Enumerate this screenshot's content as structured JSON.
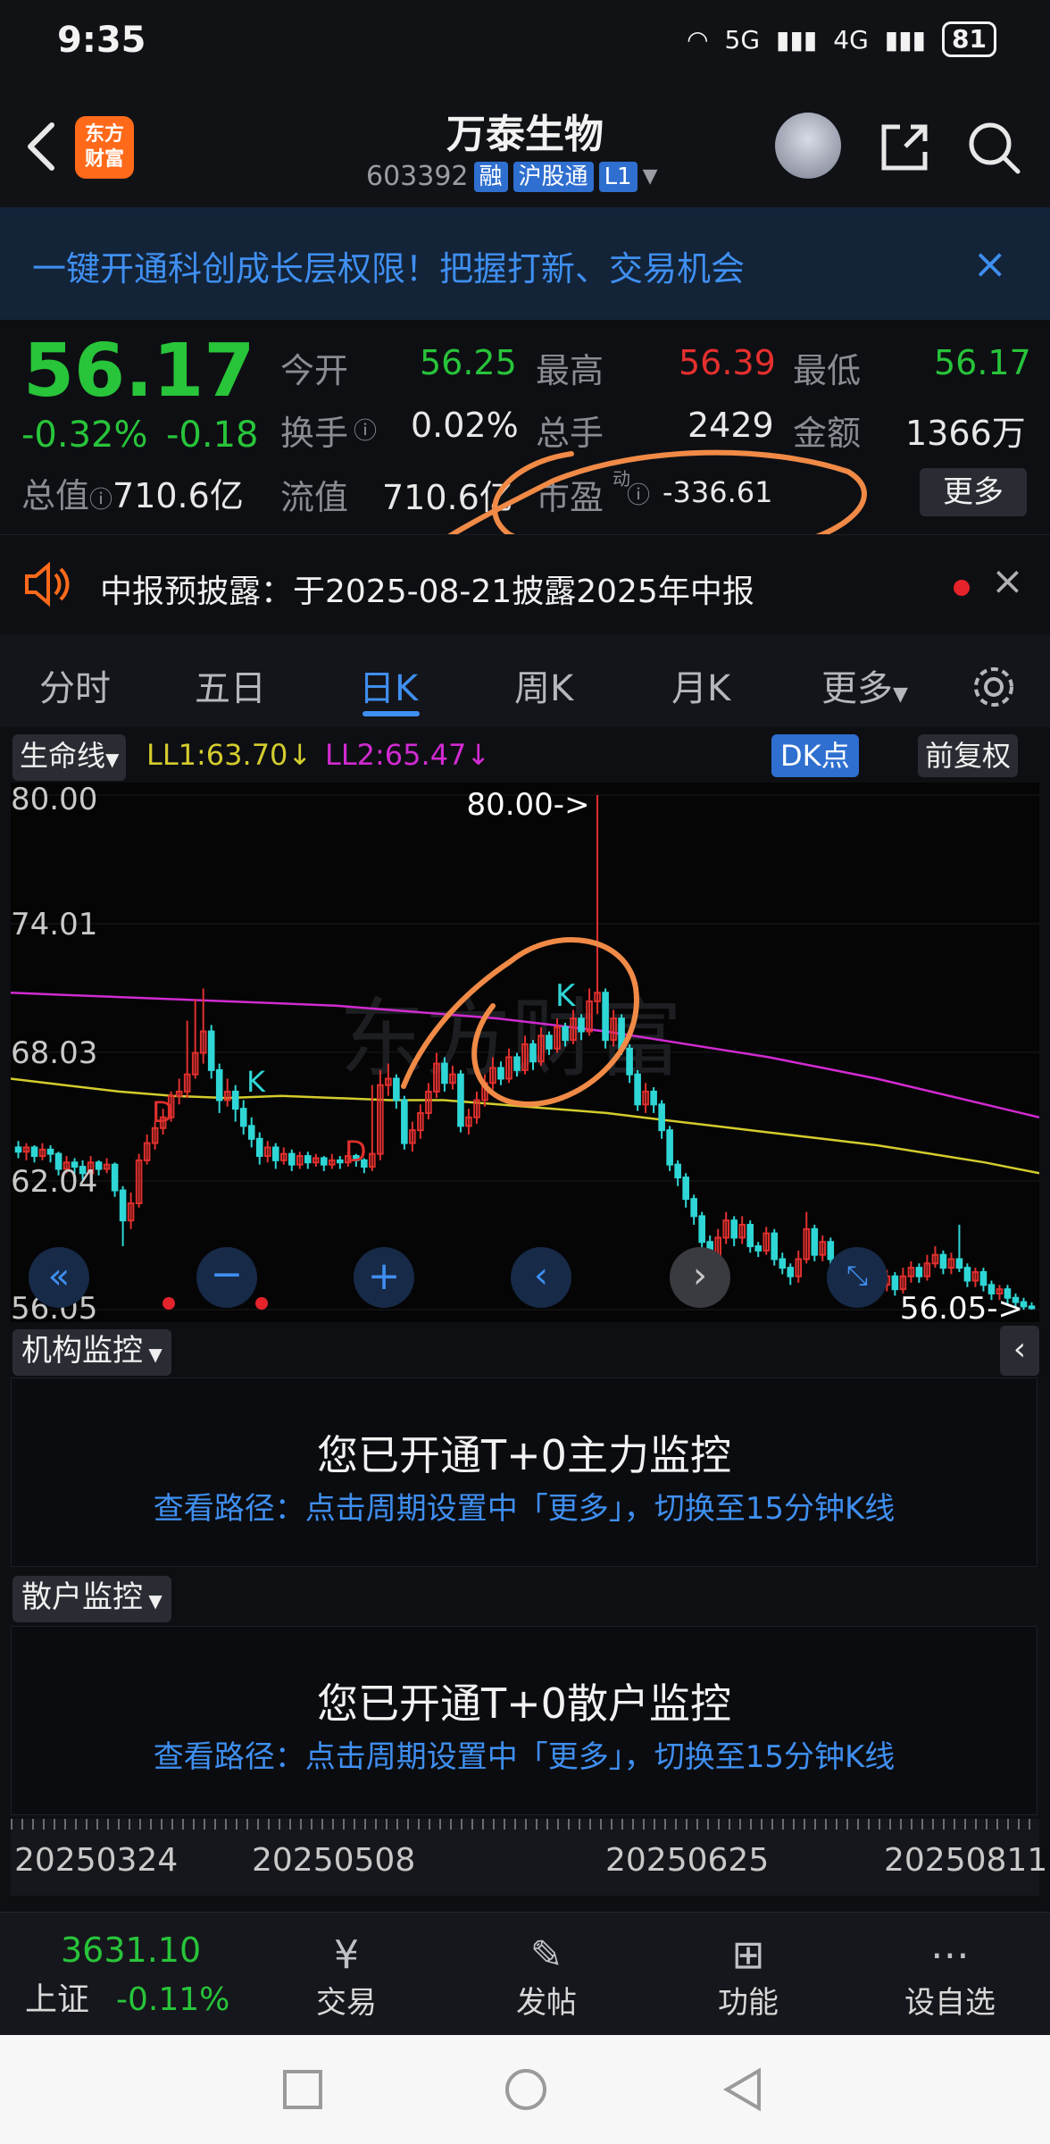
{
  "status_bar": {
    "time": "9:35",
    "net1": "5G",
    "net2": "4G",
    "battery": "81"
  },
  "header": {
    "logo_line1": "东方",
    "logo_line2": "财富",
    "stock_name": "万泰生物",
    "code": "603392",
    "tag_margin": "融",
    "tag_connect": "沪股通",
    "tag_level": "L1"
  },
  "banner": {
    "text": "一键开通科创成长层权限！把握打新、交易机会",
    "close": "×"
  },
  "quote": {
    "price": "56.17",
    "change_pct": "-0.32%",
    "change": "-0.18",
    "total_value_label": "总值",
    "total_value": "710.6亿",
    "open_label": "今开",
    "open": "56.25",
    "high_label": "最高",
    "high": "56.39",
    "low_label": "最低",
    "low": "56.17",
    "turnover_label": "换手",
    "turnover": "0.02%",
    "volume_label": "总手",
    "volume": "2429",
    "amount_label": "金额",
    "amount": "1366万",
    "float_label": "流值",
    "float_value": "710.6亿",
    "pe_label": "市盈",
    "pe_sup": "动",
    "pe": "-336.61",
    "more": "更多"
  },
  "notice": {
    "text": "中报预披露：于2025-08-21披露2025年中报"
  },
  "tabs": [
    {
      "label": "分时"
    },
    {
      "label": "五日"
    },
    {
      "label": "日K"
    },
    {
      "label": "周K"
    },
    {
      "label": "月K"
    },
    {
      "label": "更多"
    }
  ],
  "indicator": {
    "name": "生命线",
    "ll1": "LL1:63.70↓",
    "ll2": "LL2:65.47↓",
    "dk": "DK点",
    "adjust": "前复权"
  },
  "chart_data": {
    "type": "candlestick",
    "y_ticks": [
      "80.00",
      "74.01",
      "68.03",
      "62.04",
      "56.05"
    ],
    "ylim": [
      56.05,
      80.0
    ],
    "max_label": "80.00->",
    "min_label": "56.05->",
    "markers": [
      "D",
      "K",
      "D",
      "K"
    ],
    "x_ticks": [
      "20250324",
      "20250508",
      "20250625",
      "20250811"
    ],
    "colors": {
      "up": "#e0302e",
      "down": "#2fd6d6",
      "ll1": "#d4cc2e",
      "ll2": "#d12bd1"
    },
    "candles": [
      [
        63.6,
        63.4,
        63.9,
        63.1
      ],
      [
        63.4,
        63.6,
        63.8,
        63.0
      ],
      [
        63.6,
        63.2,
        63.7,
        62.9
      ],
      [
        63.2,
        63.5,
        63.8,
        63.0
      ],
      [
        63.5,
        63.3,
        63.7,
        62.9
      ],
      [
        63.3,
        62.6,
        63.4,
        62.3
      ],
      [
        62.6,
        62.9,
        63.2,
        62.4
      ],
      [
        62.9,
        62.7,
        63.1,
        62.4
      ],
      [
        62.7,
        62.4,
        63.0,
        62.1
      ],
      [
        62.4,
        62.9,
        63.2,
        62.2
      ],
      [
        62.9,
        62.6,
        63.0,
        62.3
      ],
      [
        62.6,
        62.8,
        63.1,
        62.4
      ],
      [
        62.8,
        61.6,
        62.9,
        61.3
      ],
      [
        61.6,
        60.2,
        61.8,
        59.0
      ],
      [
        60.2,
        61.0,
        61.5,
        59.8
      ],
      [
        61.0,
        63.0,
        63.3,
        60.8
      ],
      [
        63.0,
        63.8,
        64.2,
        62.8
      ],
      [
        63.8,
        64.5,
        64.8,
        63.5
      ],
      [
        64.5,
        65.0,
        65.4,
        64.2
      ],
      [
        65.0,
        66.0,
        66.2,
        64.8
      ],
      [
        66.0,
        66.2,
        66.8,
        65.6
      ],
      [
        66.2,
        67.0,
        69.5,
        65.9
      ],
      [
        67.0,
        68.0,
        70.5,
        66.8
      ],
      [
        68.0,
        69.0,
        71.0,
        67.5
      ],
      [
        69.0,
        67.2,
        69.3,
        66.8
      ],
      [
        67.2,
        65.8,
        67.5,
        65.2
      ],
      [
        65.8,
        66.2,
        66.8,
        65.5
      ],
      [
        66.2,
        65.4,
        66.5,
        64.8
      ],
      [
        65.4,
        64.6,
        65.8,
        64.2
      ],
      [
        64.6,
        64.0,
        65.0,
        63.6
      ],
      [
        64.0,
        63.2,
        64.3,
        62.8
      ],
      [
        63.2,
        63.6,
        63.9,
        62.9
      ],
      [
        63.6,
        63.0,
        63.8,
        62.6
      ],
      [
        63.0,
        63.3,
        63.6,
        62.8
      ],
      [
        63.3,
        62.8,
        63.5,
        62.5
      ],
      [
        62.8,
        63.2,
        63.4,
        62.6
      ],
      [
        63.2,
        62.9,
        63.4,
        62.6
      ],
      [
        62.9,
        63.1,
        63.3,
        62.7
      ],
      [
        63.1,
        62.8,
        63.2,
        62.5
      ],
      [
        62.8,
        63.0,
        63.3,
        62.6
      ],
      [
        63.0,
        62.9,
        63.2,
        62.6
      ],
      [
        62.9,
        63.2,
        63.4,
        62.7
      ],
      [
        63.2,
        63.0,
        63.3,
        62.7
      ],
      [
        63.0,
        62.7,
        63.1,
        62.4
      ],
      [
        62.7,
        63.3,
        66.5,
        62.5
      ],
      [
        63.3,
        66.5,
        67.2,
        63.0
      ],
      [
        66.5,
        66.8,
        67.5,
        66.0
      ],
      [
        66.8,
        65.8,
        67.0,
        65.4
      ],
      [
        65.8,
        63.8,
        66.0,
        63.5
      ],
      [
        63.8,
        64.4,
        64.8,
        63.4
      ],
      [
        64.4,
        65.2,
        65.6,
        64.0
      ],
      [
        65.2,
        66.2,
        66.6,
        64.9
      ],
      [
        66.2,
        67.5,
        68.0,
        65.9
      ],
      [
        67.5,
        66.6,
        67.8,
        66.2
      ],
      [
        66.6,
        67.0,
        67.4,
        66.3
      ],
      [
        67.0,
        64.6,
        67.2,
        64.3
      ],
      [
        64.6,
        65.0,
        65.4,
        64.2
      ],
      [
        65.0,
        65.8,
        66.2,
        64.7
      ],
      [
        65.8,
        66.6,
        67.0,
        65.5
      ],
      [
        66.6,
        67.3,
        67.8,
        66.3
      ],
      [
        67.3,
        66.8,
        67.6,
        66.5
      ],
      [
        66.8,
        67.8,
        68.2,
        66.6
      ],
      [
        67.8,
        67.2,
        68.0,
        66.9
      ],
      [
        67.2,
        68.4,
        68.8,
        67.0
      ],
      [
        68.4,
        67.6,
        68.6,
        67.2
      ],
      [
        67.6,
        68.8,
        69.2,
        67.4
      ],
      [
        68.8,
        68.2,
        69.0,
        67.9
      ],
      [
        68.2,
        69.2,
        69.6,
        68.0
      ],
      [
        69.2,
        68.6,
        69.4,
        68.3
      ],
      [
        68.6,
        69.6,
        70.0,
        68.4
      ],
      [
        69.6,
        69.0,
        69.8,
        68.6
      ],
      [
        69.0,
        70.4,
        71.0,
        68.8
      ],
      [
        70.4,
        70.8,
        80.0,
        69.8
      ],
      [
        70.8,
        68.6,
        71.0,
        68.2
      ],
      [
        68.6,
        69.6,
        70.0,
        68.3
      ],
      [
        69.6,
        68.2,
        69.8,
        67.9
      ],
      [
        68.2,
        67.0,
        68.4,
        66.6
      ],
      [
        67.0,
        65.6,
        67.2,
        65.3
      ],
      [
        65.6,
        66.2,
        66.6,
        65.2
      ],
      [
        66.2,
        65.6,
        66.4,
        65.2
      ],
      [
        65.6,
        64.4,
        65.8,
        64.0
      ],
      [
        64.4,
        62.8,
        64.6,
        62.5
      ],
      [
        62.8,
        62.2,
        63.0,
        61.8
      ],
      [
        62.2,
        61.2,
        62.4,
        60.8
      ],
      [
        61.2,
        60.4,
        61.4,
        60.0
      ],
      [
        60.4,
        59.2,
        60.6,
        58.9
      ],
      [
        59.2,
        58.6,
        59.5,
        58.2
      ],
      [
        58.6,
        59.4,
        59.8,
        58.3
      ],
      [
        59.4,
        60.2,
        60.6,
        59.1
      ],
      [
        60.2,
        59.4,
        60.4,
        59.0
      ],
      [
        59.4,
        60.0,
        60.4,
        59.1
      ],
      [
        60.0,
        59.0,
        60.2,
        58.7
      ],
      [
        59.0,
        58.8,
        59.2,
        58.5
      ],
      [
        58.8,
        59.6,
        59.9,
        58.6
      ],
      [
        59.6,
        58.4,
        59.8,
        58.1
      ],
      [
        58.4,
        58.0,
        58.7,
        57.7
      ],
      [
        58.0,
        57.6,
        58.2,
        57.2
      ],
      [
        57.6,
        58.4,
        58.8,
        57.3
      ],
      [
        58.4,
        59.8,
        60.6,
        58.2
      ],
      [
        59.8,
        58.6,
        60.0,
        58.3
      ],
      [
        58.6,
        59.2,
        59.5,
        58.3
      ],
      [
        59.2,
        58.4,
        59.4,
        58.1
      ],
      [
        58.4,
        58.0,
        58.6,
        57.7
      ],
      [
        58.0,
        57.8,
        58.2,
        57.5
      ],
      [
        57.8,
        58.4,
        58.7,
        57.6
      ],
      [
        58.4,
        58.0,
        58.6,
        57.7
      ],
      [
        58.0,
        57.4,
        58.2,
        57.1
      ],
      [
        57.4,
        57.2,
        57.6,
        56.9
      ],
      [
        57.2,
        57.6,
        57.9,
        56.9
      ],
      [
        57.6,
        57.0,
        57.8,
        56.7
      ],
      [
        57.0,
        57.6,
        58.0,
        56.8
      ],
      [
        57.6,
        58.0,
        58.3,
        57.3
      ],
      [
        58.0,
        57.6,
        58.2,
        57.3
      ],
      [
        57.6,
        58.2,
        58.6,
        57.4
      ],
      [
        58.2,
        58.6,
        59.0,
        58.0
      ],
      [
        58.6,
        58.0,
        58.8,
        57.7
      ],
      [
        58.0,
        58.4,
        58.7,
        57.7
      ],
      [
        58.4,
        58.0,
        60.0,
        57.8
      ],
      [
        58.0,
        57.4,
        58.2,
        57.1
      ],
      [
        57.4,
        57.8,
        58.0,
        57.1
      ],
      [
        57.8,
        57.2,
        58.0,
        56.9
      ],
      [
        57.2,
        56.8,
        57.4,
        56.5
      ],
      [
        56.8,
        57.0,
        57.2,
        56.5
      ],
      [
        57.0,
        56.6,
        57.2,
        56.3
      ],
      [
        56.6,
        56.4,
        56.8,
        56.1
      ],
      [
        56.4,
        56.2,
        56.6,
        56.05
      ],
      [
        56.2,
        56.17,
        56.39,
        56.05
      ]
    ],
    "ll1": [
      66.8,
      66.5,
      66.2,
      66.0,
      65.9,
      66.0,
      65.9,
      65.8,
      65.8,
      65.6,
      65.4,
      65.2,
      64.9,
      64.6,
      64.3,
      64.0,
      63.7,
      63.3,
      62.9,
      62.4
    ],
    "ll2": [
      70.8,
      70.7,
      70.6,
      70.5,
      70.4,
      70.3,
      70.2,
      70.0,
      69.8,
      69.6,
      69.3,
      69.0,
      68.6,
      68.2,
      67.8,
      67.3,
      66.8,
      66.2,
      65.6,
      65.0
    ]
  },
  "panels": {
    "inst": {
      "title": "机构监控",
      "heading": "您已开通T+0主力监控",
      "path": "查看路径：点击周期设置中「更多」，切换至15分钟K线"
    },
    "retail": {
      "title": "散户监控",
      "heading": "您已开通T+0散户监控",
      "path": "查看路径：点击周期设置中「更多」，切换至15分钟K线"
    }
  },
  "bottom": {
    "index_value": "3631.10",
    "index_name": "上证",
    "index_change": "-0.11%",
    "items": [
      {
        "label": "交易"
      },
      {
        "label": "发帖"
      },
      {
        "label": "功能"
      },
      {
        "label": "设自选"
      }
    ]
  },
  "watermark": "东方财富"
}
